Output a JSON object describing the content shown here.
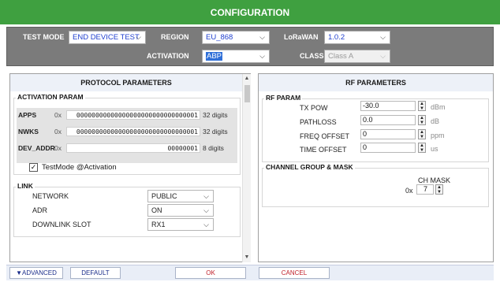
{
  "title": "CONFIGURATION",
  "header": {
    "test_mode_label": "TEST MODE",
    "test_mode_value": "END DEVICE TEST",
    "region_label": "REGION",
    "region_value": "EU_868",
    "activation_label": "ACTIVATION",
    "activation_value": "ABP",
    "lorawan_label": "LoRaWAN",
    "lorawan_value": "1.0.2",
    "class_label": "CLASS",
    "class_value": "Class A"
  },
  "protocol": {
    "header": "PROTOCOL PARAMETERS",
    "activation_group": "ACTIVATION PARAM",
    "params": [
      {
        "label": "APPS",
        "prefix": "0x",
        "value": "00000000000000000000000000000001",
        "digits": "32 digits"
      },
      {
        "label": "NWKS",
        "prefix": "0x",
        "value": "00000000000000000000000000000001",
        "digits": "32 digits"
      },
      {
        "label": "DEV_ADDR",
        "prefix": "0x",
        "value": "00000001",
        "digits": "8 digits"
      }
    ],
    "testmode_label": "TestMode @Activation",
    "testmode_checked": true,
    "link_group": "LINK",
    "link": [
      {
        "label": "NETWORK",
        "value": "PUBLIC"
      },
      {
        "label": "ADR",
        "value": "ON"
      },
      {
        "label": "DOWNLINK SLOT",
        "value": "RX1"
      }
    ]
  },
  "rf": {
    "header": "RF PARAMETERS",
    "group": "RF PARAM",
    "params": [
      {
        "label": "TX POW",
        "value": "-30.0",
        "unit": "dBm"
      },
      {
        "label": "PATHLOSS",
        "value": "0.0",
        "unit": "dB"
      },
      {
        "label": "FREQ OFFSET",
        "value": "0",
        "unit": "ppm"
      },
      {
        "label": "TIME OFFSET",
        "value": "0",
        "unit": "us"
      }
    ],
    "channel_group": "CHANNEL GROUP & MASK",
    "ch_mask_label": "CH MASK",
    "ch_mask_prefix": "0x",
    "ch_mask_value": "7"
  },
  "footer": {
    "advanced_label": "▼ADVANCED",
    "default_label": "DEFAULT",
    "ok_label": "OK",
    "cancel_label": "CANCEL"
  },
  "colors": {
    "title_bg": "#3fa040",
    "header_bg": "#7b7b7b",
    "value_text": "#1f3fcf",
    "selection": "#2f6fd8",
    "ok_cancel_text": "#c0202a"
  }
}
